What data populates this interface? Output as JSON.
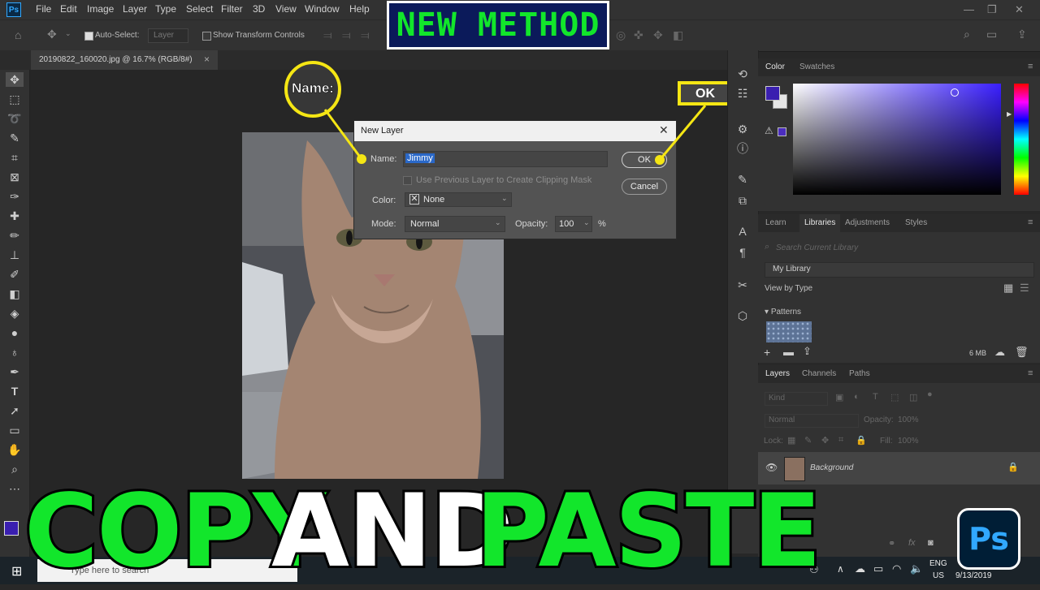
{
  "menubar": {
    "app_icon": "Ps",
    "items": [
      "File",
      "Edit",
      "Image",
      "Layer",
      "Type",
      "Select",
      "Filter",
      "3D",
      "View",
      "Window",
      "Help"
    ]
  },
  "options_bar": {
    "auto_select_label": "Auto-Select:",
    "auto_select_value": "Layer",
    "show_transform_label": "Show Transform Controls"
  },
  "document_tab": {
    "title": "20190822_160020.jpg @ 16.7% (RGB/8#)",
    "close": "×"
  },
  "dialog": {
    "title": "New Layer",
    "name_label": "Name:",
    "name_value": "Jimmy",
    "clipping_label": "Use Previous Layer to Create Clipping Mask",
    "color_label": "Color:",
    "color_value": "None",
    "mode_label": "Mode:",
    "mode_value": "Normal",
    "opacity_label": "Opacity:",
    "opacity_value": "100",
    "opacity_unit": "%",
    "ok_label": "OK",
    "cancel_label": "Cancel"
  },
  "callouts": {
    "name_callout": "Name:",
    "ok_callout": "OK"
  },
  "color_panel": {
    "tabs": [
      "Color",
      "Swatches"
    ],
    "foreground": "#3a1fb0"
  },
  "libraries_panel": {
    "tabs": [
      "Learn",
      "Libraries",
      "Adjustments",
      "Styles"
    ],
    "search_placeholder": "Search Current Library",
    "library_name": "My Library",
    "view_by": "View by Type",
    "patterns_label": "Patterns",
    "size": "6 MB"
  },
  "layers_panel": {
    "tabs": [
      "Layers",
      "Channels",
      "Paths"
    ],
    "filter_kind": "Kind",
    "blend_mode": "Normal",
    "opacity_label": "Opacity:",
    "opacity_value": "100%",
    "lock_label": "Lock:",
    "fill_label": "Fill:",
    "fill_value": "100%",
    "layers": [
      {
        "name": "Background"
      }
    ]
  },
  "overlay": {
    "banner": "NEW METHOD",
    "word1": "COPY",
    "word2": "AND",
    "word3": "PASTE",
    "ps_logo": "Ps"
  },
  "taskbar": {
    "lang1": "ENG",
    "lang2": "US",
    "date": "9/13/2019",
    "search_placeholder": "Type here to search"
  },
  "colors": {
    "accent_yellow": "#f5e614",
    "green_text": "#12e62b",
    "panel_bg": "#323232"
  }
}
